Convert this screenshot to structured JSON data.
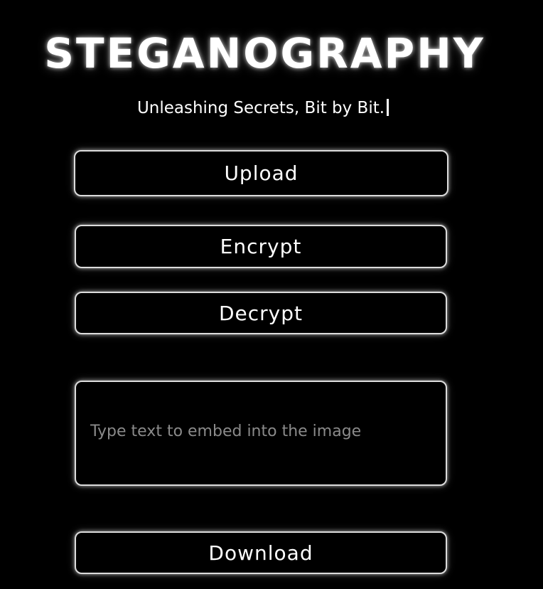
{
  "header": {
    "title": "STEGANOGRAPHY",
    "tagline": "Unleashing Secrets, Bit by Bit."
  },
  "actions": {
    "upload_label": "Upload",
    "encrypt_label": "Encrypt",
    "decrypt_label": "Decrypt",
    "download_label": "Download"
  },
  "message_input": {
    "value": "",
    "placeholder": "Type text to embed into the image"
  },
  "colors": {
    "background": "#000000",
    "text": "#ffffff",
    "border": "#dcdcdc",
    "placeholder": "#8a8a8a"
  }
}
